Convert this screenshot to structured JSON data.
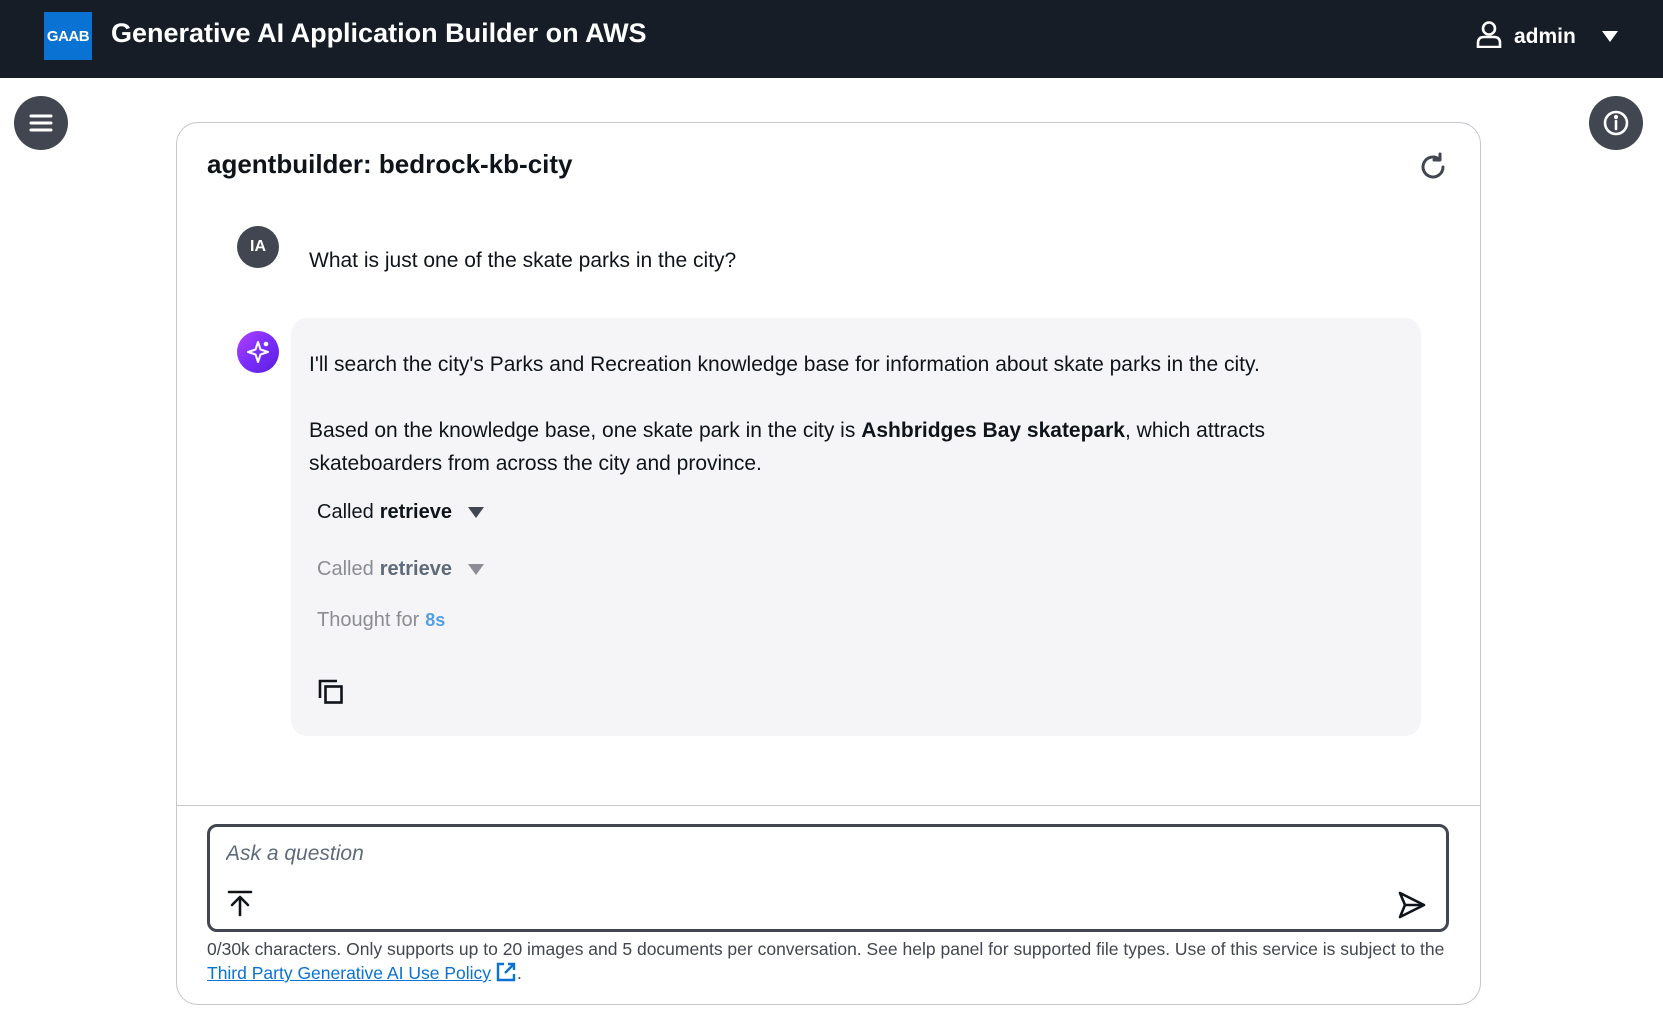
{
  "header": {
    "logo_text": "GAAB",
    "title": "Generative AI Application Builder on AWS",
    "user_name": "admin"
  },
  "chat": {
    "title": "agentbuilder: bedrock-kb-city",
    "user_avatar": "IA",
    "user_message": "What is just one of the skate parks in the city?",
    "ai_paragraph1": "I'll search the city's Parks and Recreation knowledge base for information about skate parks in the city.",
    "ai_paragraph2_prefix": "Based on the knowledge base, one skate park in the city is ",
    "ai_paragraph2_bold": "Ashbridges Bay skatepark",
    "ai_paragraph2_suffix": ", which attracts skateboarders from across the city and province.",
    "tool_calls": [
      {
        "prefix": "Called",
        "name": "retrieve"
      },
      {
        "prefix": "Called",
        "name": "retrieve"
      }
    ],
    "thought_label": "Thought for",
    "thought_duration": "8s"
  },
  "input": {
    "placeholder": "Ask a question"
  },
  "footer": {
    "text_before": "0/30k characters. Only supports up to 20 images and 5 documents per conversation. See help panel for supported file types. Use of this service is subject to the ",
    "link_text": "Third Party Generative AI Use Policy",
    "text_after": "."
  },
  "icons": {
    "menu": "hamburger-icon",
    "info": "info-icon",
    "user": "user-icon",
    "refresh": "refresh-icon",
    "copy": "copy-icon",
    "upload": "upload-icon",
    "send": "send-icon",
    "ai": "sparkle-icon",
    "external": "external-link-icon"
  },
  "colors": {
    "topbar": "#161d26",
    "brand": "#0972d3",
    "ai_accent": "#7a2dff",
    "bubble": "#f5f5f7"
  }
}
